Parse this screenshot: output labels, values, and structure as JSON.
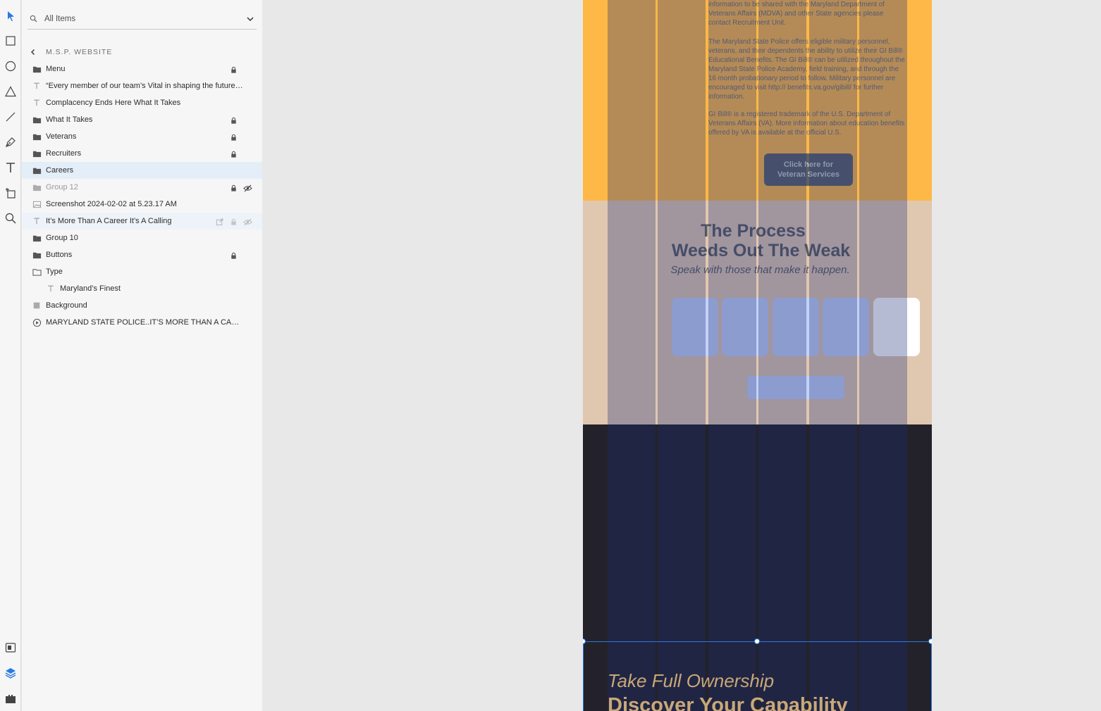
{
  "search": {
    "label": "All Items"
  },
  "breadcrumb": {
    "label": "M.S.P. WEBSITE"
  },
  "layers": [
    {
      "name": "Menu",
      "icon": "folder-icon",
      "locked": true
    },
    {
      "name": "“Every member of our team’s Vital  in shaping the future…",
      "icon": "text-icon"
    },
    {
      "name": "Complacency Ends Here What It Takes",
      "icon": "text-icon"
    },
    {
      "name": "What It Takes",
      "icon": "folder-icon",
      "locked": true
    },
    {
      "name": "Veterans",
      "icon": "folder-icon",
      "locked": true
    },
    {
      "name": "Recruiters",
      "icon": "folder-icon",
      "locked": true
    },
    {
      "name": "Careers",
      "icon": "folder-icon",
      "selected": true
    },
    {
      "name": "Group 12",
      "icon": "folder-icon",
      "locked": true,
      "hidden": true,
      "dim": true
    },
    {
      "name": "Screenshot 2024-02-02 at 5.23.17 AM",
      "icon": "image-icon"
    },
    {
      "name": "It’s More Than A Career It’s A Calling",
      "icon": "text-icon",
      "hover": true
    },
    {
      "name": "Group 10",
      "icon": "folder-icon"
    },
    {
      "name": "Buttons",
      "icon": "folder-icon",
      "locked": true
    },
    {
      "name": "Type",
      "icon": "folder-open-icon"
    },
    {
      "name": "Maryland’s Finest",
      "icon": "text-icon",
      "indent": true
    },
    {
      "name": "Background",
      "icon": "rectangle-icon"
    },
    {
      "name": "MARYLAND STATE POLICE..IT’S MORE THAN A CAREER,…",
      "icon": "video-icon"
    }
  ],
  "canvas": {
    "para1": "information to be shared with the Maryland Department of Veterans Affairs (MDVA) and other State agencies please contact Recruitment Unit.",
    "para2": "The Maryland State Police offers eligible military personnel, veterans, and their dependents the ability to utilize their GI Bill® Educational Benefits. The GI Bill® can be utilized throughout the Maryland State Police Academy, field training, and through the 16 month probationary period to follow. Military personnel are encouraged to visit http:// benefits.va.gov/gibill/ for further information.",
    "para3": "GI Bill® is a registered trademark of the U.S. Department of Veterans Affairs (VA). More information about education benefits offered by VA is available at the official U.S.",
    "vet_button_line1": "Click here for",
    "vet_button_line2": "Veteran Services",
    "heading_line1": "The Process",
    "heading_line2": "Weeds Out The Weak",
    "subheading": "Speak with those that make it happen.",
    "ownership": "Take Full Ownership",
    "discover": "Discover Your Capability"
  },
  "colors": {
    "accent": "#2a7ae2",
    "section_yellow": "#fdb847",
    "section_tan": "#e0c7b0",
    "section_dark": "#23222a",
    "grid_column": "#1c2d5e"
  }
}
